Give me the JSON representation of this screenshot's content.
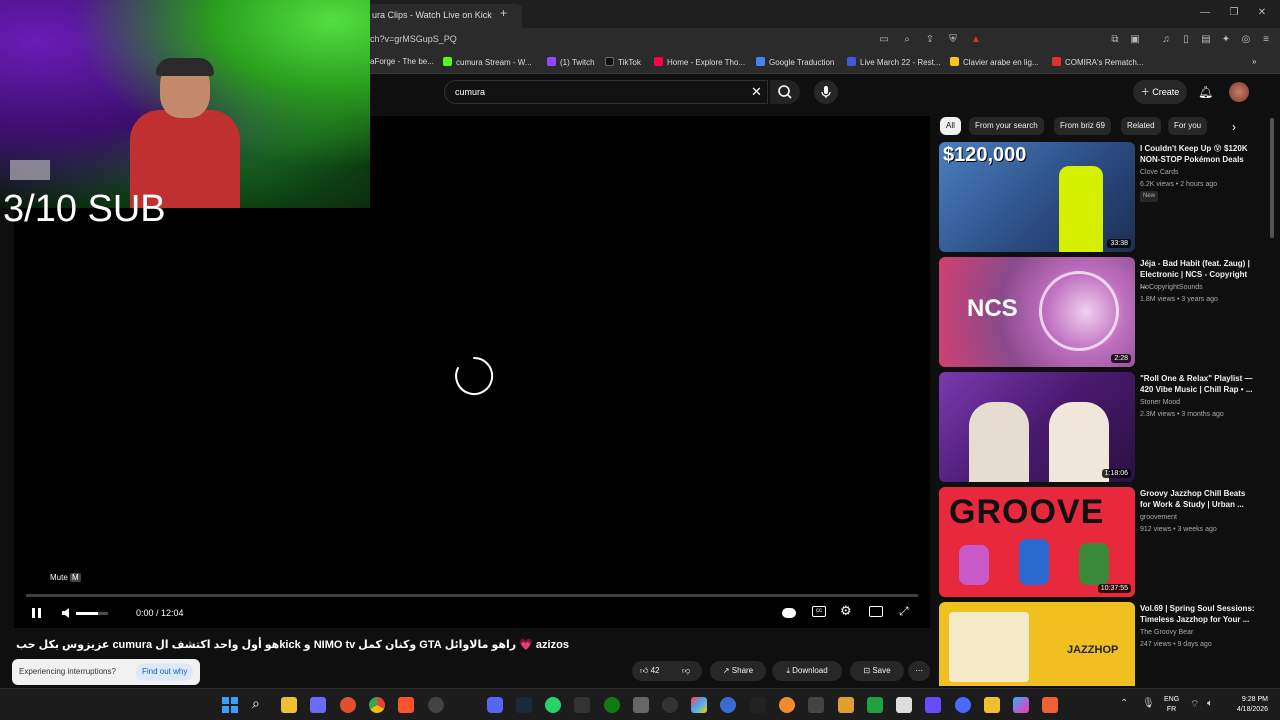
{
  "browser": {
    "tab_title": "ura Clips - Watch Live on Kick",
    "new_tab": "+",
    "url": "ch?v=grMSGupS_PQ",
    "bookmarks": [
      {
        "label": "aForge - The be...",
        "color": "#ff6d00"
      },
      {
        "label": "cumura Stream - W...",
        "color": "#53fc18"
      },
      {
        "label": "(1) Twitch",
        "color": "#9146ff"
      },
      {
        "label": "TikTok",
        "color": "#111111"
      },
      {
        "label": "Home - Explore Tho...",
        "color": "#ff0044"
      },
      {
        "label": "Google Traduction",
        "color": "#4285f4"
      },
      {
        "label": "Live March 22 - Rest...",
        "color": "#3b5bdb"
      },
      {
        "label": "Clavier arabe en lig...",
        "color": "#f5c518"
      },
      {
        "label": "COMIRA's Rematch...",
        "color": "#e03131"
      }
    ]
  },
  "youtube": {
    "search_value": "cumura",
    "create_label": "Create"
  },
  "player": {
    "overlay_text": "3/10 SUB",
    "mute_tooltip": "Mute",
    "mute_key": "M",
    "time": "0:00 / 12:04",
    "progress": 0,
    "volume": 0.7
  },
  "video": {
    "title": "azizos 💗 راهو مالاوائل GTA وكنان كمل NIMO tv و kickهو أول واحد اكتشف ال cumura عزيزوس بكل حب",
    "likes": "42",
    "share_label": "Share",
    "download_label": "Download",
    "save_label": "Save"
  },
  "toast": {
    "text": "Experiencing interruptions?",
    "link": "Find out why"
  },
  "chips": [
    "All",
    "From your search",
    "From briz 69",
    "Related",
    "For you"
  ],
  "recommendations": [
    {
      "title": "I Couldn't Keep Up 😵 $120K NON-STOP Pokémon Deals",
      "channel": "Clove Cards",
      "meta": "6.2K views • 2 hours ago",
      "badge": "New",
      "duration": "33:38",
      "thumb_text": "$120,000",
      "bg": "#3d6fb0"
    },
    {
      "title": "Jéja - Bad Habit (feat. Zaug) | Electronic | NCS - Copyright ...",
      "channel": "NoCopyrightSounds",
      "meta": "1.8M views • 3 years ago",
      "badge": "",
      "duration": "2:28",
      "thumb_text": "NCS",
      "bg": "#8a4a8c"
    },
    {
      "title": "\"Roll One & Relax\" Playlist — 420 Vibe Music | Chill Rap • ...",
      "channel": "Stoner Mood",
      "meta": "2.3M views • 3 months ago",
      "badge": "",
      "duration": "1:18:06",
      "thumb_text": "",
      "bg": "#5a2a80"
    },
    {
      "title": "Groovy Jazzhop Chill Beats for Work & Study | Urban ...",
      "channel": "groovement",
      "meta": "912 views • 3 weeks ago",
      "badge": "",
      "duration": "10:37:55",
      "thumb_text": "GROOVE",
      "bg": "#e8283c"
    },
    {
      "title": "Vol.69 | Spring Soul Sessions: Timeless Jazzhop for Your ...",
      "channel": "The Groovy Bear",
      "meta": "247 views • 9 days ago",
      "badge": "",
      "duration": "",
      "thumb_text": "JAZZHOP",
      "bg": "#f0c020"
    }
  ],
  "taskbar": {
    "lang_top": "ENG",
    "lang_bottom": "FR",
    "time": "9:28 PM",
    "date": "4/18/2026"
  }
}
